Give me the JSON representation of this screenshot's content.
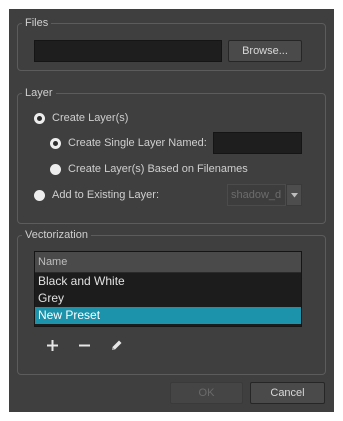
{
  "files": {
    "legend": "Files",
    "path_value": "",
    "browse_label": "Browse..."
  },
  "layer": {
    "legend": "Layer",
    "create_layers_label": "Create Layer(s)",
    "create_single_label": "Create Single Layer Named:",
    "single_name_value": "",
    "based_on_filenames_label": "Create Layer(s) Based on Filenames",
    "add_existing_label": "Add to Existing Layer:",
    "existing_layer_value": "shadow_d"
  },
  "vectorization": {
    "legend": "Vectorization",
    "column_header": "Name",
    "presets": [
      {
        "label": "Black and White",
        "selected": false
      },
      {
        "label": "Grey",
        "selected": false
      },
      {
        "label": "New Preset",
        "selected": true
      }
    ],
    "tools": [
      "plus-icon",
      "minus-icon",
      "pencil-icon"
    ]
  },
  "footer": {
    "ok_label": "OK",
    "cancel_label": "Cancel"
  },
  "colors": {
    "dialog_bg": "#3f3f3f",
    "selection": "#1d93ab",
    "field_bg": "#1e1e1e"
  }
}
